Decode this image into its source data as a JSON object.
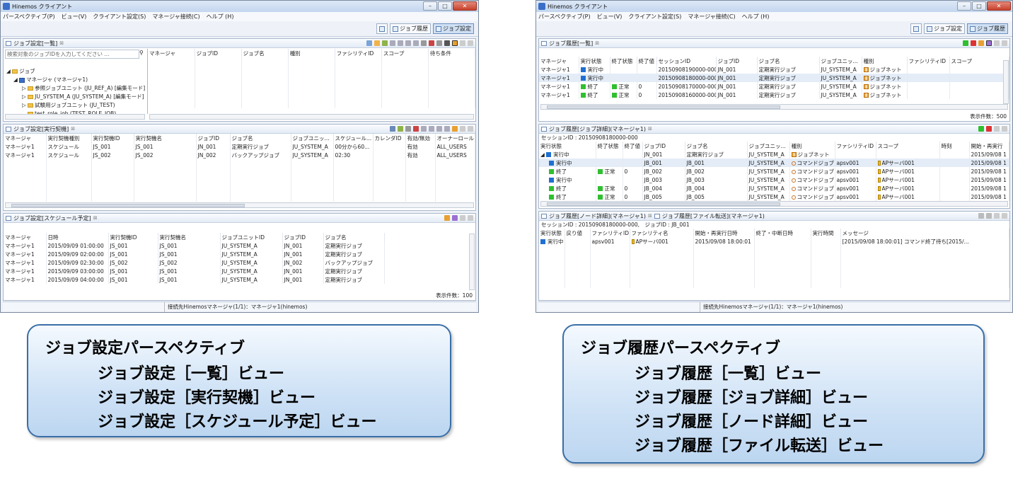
{
  "app_title": "Hinemos クライアント",
  "menu": [
    "パースペクティブ(P)",
    "ビュー(V)",
    "クライアント設定(S)",
    "マネージャ接続(C)",
    "ヘルプ (H)"
  ],
  "perspective_buttons": {
    "job_history": "ジョブ履歴",
    "job_settings": "ジョブ設定"
  },
  "status_text": "接続先Hinemosマネージャ(1/1)：マネージャ1(hinemos)",
  "win_a": {
    "list_view": {
      "title": "ジョブ設定[一覧]",
      "search_placeholder": "検索対象のジョブIDを入力してください ...",
      "tree": [
        {
          "label": "ジョブ",
          "icon": "folder-icon"
        },
        {
          "label": "マネージャ (マネージャ1)",
          "icon": "manager-icon"
        },
        {
          "label": "参照ジョブユニット (JU_REF_A) [編集モード]",
          "icon": "folder-icon"
        },
        {
          "label": "JU_SYSTEM_A (JU_SYSTEM_A) [編集モード]",
          "icon": "folder-icon"
        },
        {
          "label": "試験用ジョブユニット (JU_TEST)",
          "icon": "folder-icon"
        },
        {
          "label": "test_role_job (TEST_ROLE_JOB)",
          "icon": "folder-icon"
        }
      ],
      "columns": [
        "マネージャ",
        "ジョブID",
        "ジョブ名",
        "種別",
        "ファシリティID",
        "スコープ",
        "待ち条件"
      ]
    },
    "kick_view": {
      "title": "ジョブ設定[実行契機]",
      "columns": [
        "マネージャ",
        "実行契機種別",
        "実行契機ID",
        "実行契機名",
        "ジョブID",
        "ジョブ名",
        "ジョブユニッ...",
        "スケジュール...",
        "カレンダID",
        "有効/無効",
        "オーナーロール"
      ],
      "rows": [
        [
          "マネージャ1",
          "スケジュール",
          "JS_001",
          "JS_001",
          "JN_001",
          "定期実行ジョブ",
          "JU_SYSTEM_A",
          "00分から60...",
          "",
          "有効",
          "ALL_USERS"
        ],
        [
          "マネージャ1",
          "スケジュール",
          "JS_002",
          "JS_002",
          "JN_002",
          "バックアップジョブ",
          "JU_SYSTEM_A",
          "02:30",
          "",
          "有効",
          "ALL_USERS"
        ]
      ]
    },
    "schedule_view": {
      "title": "ジョブ設定[スケジュール予定]",
      "columns": [
        "マネージャ",
        "日時",
        "実行契機ID",
        "実行契機名",
        "ジョブユニットID",
        "ジョブID",
        "ジョブ名"
      ],
      "rows": [
        [
          "マネージャ1",
          "2015/09/09 01:00:00",
          "JS_001",
          "JS_001",
          "JU_SYSTEM_A",
          "JN_001",
          "定期実行ジョブ"
        ],
        [
          "マネージャ1",
          "2015/09/09 02:00:00",
          "JS_001",
          "JS_001",
          "JU_SYSTEM_A",
          "JN_001",
          "定期実行ジョブ"
        ],
        [
          "マネージャ1",
          "2015/09/09 02:30:00",
          "JS_002",
          "JS_002",
          "JU_SYSTEM_A",
          "JN_002",
          "バックアップジョブ"
        ],
        [
          "マネージャ1",
          "2015/09/09 03:00:00",
          "JS_001",
          "JS_001",
          "JU_SYSTEM_A",
          "JN_001",
          "定期実行ジョブ"
        ],
        [
          "マネージャ1",
          "2015/09/09 04:00:00",
          "JS_001",
          "JS_001",
          "JU_SYSTEM_A",
          "JN_001",
          "定期実行ジョブ"
        ]
      ],
      "count": "表示件数：100"
    }
  },
  "win_b": {
    "history_list": {
      "title": "ジョブ履歴[一覧]",
      "columns": [
        "マネージャ",
        "実行状態",
        "終了状態",
        "終了値",
        "セッションID",
        "ジョブID",
        "ジョブ名",
        "ジョブユニッ...",
        "種別",
        "ファシリティID",
        "スコープ"
      ],
      "rows": [
        {
          "mgr": "マネージャ1",
          "state": "実行中",
          "state_color": "#1f6fd1",
          "end": "",
          "end_color": "",
          "val": "",
          "session": "20150908190000-000",
          "job": "JN_001",
          "name": "定期実行ジョブ",
          "unit": "JU_SYSTEM_A",
          "type": "ジョブネット"
        },
        {
          "mgr": "マネージャ1",
          "state": "実行中",
          "state_color": "#1f6fd1",
          "end": "",
          "end_color": "",
          "val": "",
          "session": "20150908180000-000",
          "job": "JN_001",
          "name": "定期実行ジョブ",
          "unit": "JU_SYSTEM_A",
          "type": "ジョブネット"
        },
        {
          "mgr": "マネージャ1",
          "state": "終了",
          "state_color": "#2fbf2f",
          "end": "正常",
          "end_color": "#2fbf2f",
          "val": "0",
          "session": "20150908170000-000",
          "job": "JN_001",
          "name": "定期実行ジョブ",
          "unit": "JU_SYSTEM_A",
          "type": "ジョブネット"
        },
        {
          "mgr": "マネージャ1",
          "state": "終了",
          "state_color": "#2fbf2f",
          "end": "正常",
          "end_color": "#2fbf2f",
          "val": "0",
          "session": "20150908160000-000",
          "job": "JN_001",
          "name": "定期実行ジョブ",
          "unit": "JU_SYSTEM_A",
          "type": "ジョブネット"
        }
      ],
      "count": "表示件数：500"
    },
    "detail_view": {
      "title": "ジョブ履歴[ジョブ詳細](マネージャ1)",
      "session_label": "セッションID : 20150908180000-000",
      "columns": [
        "実行状態",
        "終了状態",
        "終了値",
        "ジョブID",
        "ジョブ名",
        "ジョブユニッ...",
        "種別",
        "ファシリティID",
        "スコープ",
        "時刻",
        "開始・再実行"
      ],
      "rows": [
        {
          "state": "実行中",
          "state_color": "#1f6fd1",
          "end": "",
          "val": "",
          "job": "JN_001",
          "name": "定期実行ジョブ",
          "unit": "JU_SYSTEM_A",
          "type": "ジョブネット",
          "fac": "",
          "scope": "",
          "start": "2015/09/08 1"
        },
        {
          "state": "実行中",
          "state_color": "#1f6fd1",
          "end": "",
          "val": "",
          "job": "JB_001",
          "name": "JB_001",
          "unit": "JU_SYSTEM_A",
          "type": "コマンドジョブ",
          "fac": "apsv001",
          "scope": "APサーバ001",
          "start": "2015/09/08 1"
        },
        {
          "state": "終了",
          "state_color": "#2fbf2f",
          "end": "正常",
          "val": "0",
          "job": "JB_002",
          "name": "JB_002",
          "unit": "JU_SYSTEM_A",
          "type": "コマンドジョブ",
          "fac": "apsv001",
          "scope": "APサーバ001",
          "start": "2015/09/08 1"
        },
        {
          "state": "実行中",
          "state_color": "#1f6fd1",
          "end": "",
          "val": "",
          "job": "JB_003",
          "name": "JB_003",
          "unit": "JU_SYSTEM_A",
          "type": "コマンドジョブ",
          "fac": "apsv001",
          "scope": "APサーバ001",
          "start": "2015/09/08 1"
        },
        {
          "state": "終了",
          "state_color": "#2fbf2f",
          "end": "正常",
          "val": "0",
          "job": "JB_004",
          "name": "JB_004",
          "unit": "JU_SYSTEM_A",
          "type": "コマンドジョブ",
          "fac": "apsv001",
          "scope": "APサーバ001",
          "start": "2015/09/08 1"
        },
        {
          "state": "終了",
          "state_color": "#2fbf2f",
          "end": "正常",
          "val": "0",
          "job": "JB_005",
          "name": "JB_005",
          "unit": "JU_SYSTEM_A",
          "type": "コマンドジョブ",
          "fac": "apsv001",
          "scope": "APサーバ001",
          "start": "2015/09/08 1"
        }
      ]
    },
    "node_tab": "ジョブ履歴[ノード詳細](マネージャ1)",
    "file_tab": "ジョブ履歴[ファイル転送](マネージャ1)",
    "node_info": "セッションID : 20150908180000-000,　ジョブID : JB_001",
    "node_columns": [
      "実行状態",
      "戻り値",
      "ファシリティID",
      "ファシリティ名",
      "開始・再実行日時",
      "終了・中断日時",
      "実行時間",
      "メッセージ"
    ],
    "node_rows": [
      {
        "state": "実行中",
        "state_color": "#1f6fd1",
        "ret": "",
        "fac": "apsv001",
        "facname": "APサーバ001",
        "start": "2015/09/08 18:00:01",
        "end": "",
        "time": "",
        "msg": "[2015/09/08 18:00:01] コマンド終了待ち[2015/..."
      }
    ]
  },
  "callout_a": {
    "heading": "ジョブ設定パースペクティブ",
    "lines": [
      "ジョブ設定［一覧］ビュー",
      "ジョブ設定［実行契機］ビュー",
      "ジョブ設定［スケジュール予定］ビュー"
    ]
  },
  "callout_b": {
    "heading": "ジョブ履歴パースペクティブ",
    "lines": [
      "ジョブ履歴［一覧］ビュー",
      "ジョブ履歴［ジョブ詳細］ビュー",
      "ジョブ履歴［ノード詳細］ビュー",
      "ジョブ履歴［ファイル転送］ビュー"
    ]
  }
}
